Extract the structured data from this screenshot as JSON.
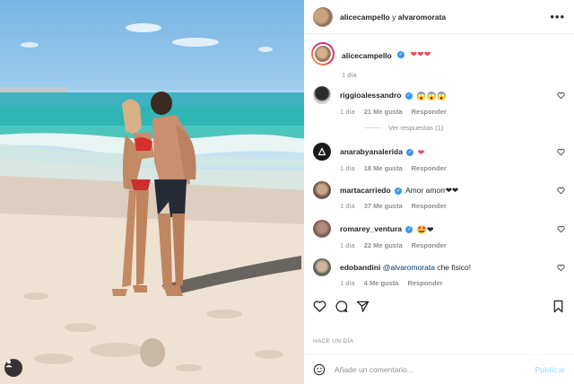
{
  "post": {
    "header": {
      "user1": "alicecampello",
      "separator": "y",
      "user2": "alvaromorata"
    },
    "caption": {
      "username": "alicecampello",
      "emojis": "❤❤❤",
      "time": "1 día"
    },
    "comments": [
      {
        "username": "riggioalessandro",
        "verified": true,
        "text": "😱😱😱",
        "time": "1 día",
        "likes": "21 Me gusta",
        "reply": "Responder",
        "replies": "Ver respuestas (1)"
      },
      {
        "username": "anarabyanalerida",
        "verified": true,
        "text": "❤",
        "time": "1 día",
        "likes": "18 Me gusta",
        "reply": "Responder"
      },
      {
        "username": "martacarriedo",
        "verified": true,
        "text": "Amor amorr❤❤",
        "time": "1 día",
        "likes": "37 Me gusta",
        "reply": "Responder"
      },
      {
        "username": "romarey_ventura",
        "verified": true,
        "text": "🤩❤",
        "time": "1 día",
        "likes": "22 Me gusta",
        "reply": "Responder"
      },
      {
        "username": "edobandini",
        "verified": false,
        "mention": "@alvaromorata",
        "text": "che fisico!",
        "time": "1 día",
        "likes": "4 Me gusta",
        "reply": "Responder"
      }
    ],
    "timestamp": "HACE UN DÍA",
    "composer": {
      "placeholder": "Añade un comentario...",
      "publish": "Publicar"
    }
  },
  "icons": {
    "more": "more-horizontal-icon",
    "like": "heart-icon",
    "comment": "comment-icon",
    "share": "paper-plane-icon",
    "save": "bookmark-icon",
    "emoji": "emoji-face-icon",
    "tagged": "user-tag-icon"
  },
  "colors": {
    "verified": "#3897f0",
    "link": "#00376b",
    "muted": "#8e8e8e",
    "publish_disabled": "#b2dffc",
    "heart": "#ed4956"
  }
}
